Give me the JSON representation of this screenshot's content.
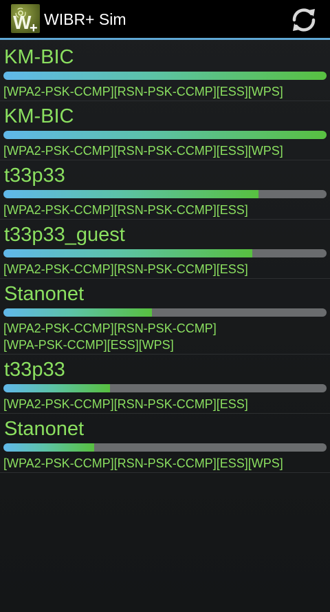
{
  "app": {
    "title": "WIBR+ Sim"
  },
  "colors": {
    "accent": "#5fa8d6",
    "text": "#8be060",
    "bar_track": "#6a6c6e"
  },
  "icons": {
    "app": "wibr-plus-logo-icon",
    "refresh": "refresh-icon"
  },
  "networks": [
    {
      "ssid": "KM-BIC",
      "signal": 1.0,
      "caps": [
        "[WPA2-PSK-CCMP][RSN-PSK-CCMP][ESS][WPS]"
      ]
    },
    {
      "ssid": "KM-BIC",
      "signal": 1.0,
      "caps": [
        "[WPA2-PSK-CCMP][RSN-PSK-CCMP][ESS][WPS]"
      ]
    },
    {
      "ssid": "t33p33",
      "signal": 0.79,
      "caps": [
        "[WPA2-PSK-CCMP][RSN-PSK-CCMP][ESS]"
      ]
    },
    {
      "ssid": "t33p33_guest",
      "signal": 0.77,
      "caps": [
        "[WPA2-PSK-CCMP][RSN-PSK-CCMP][ESS]"
      ]
    },
    {
      "ssid": "Stanonet",
      "signal": 0.46,
      "caps": [
        "[WPA2-PSK-CCMP][RSN-PSK-CCMP]",
        "[WPA-PSK-CCMP][ESS][WPS]"
      ]
    },
    {
      "ssid": "t33p33",
      "signal": 0.33,
      "caps": [
        "[WPA2-PSK-CCMP][RSN-PSK-CCMP][ESS]"
      ]
    },
    {
      "ssid": "Stanonet",
      "signal": 0.28,
      "caps": [
        "[WPA2-PSK-CCMP][RSN-PSK-CCMP][ESS][WPS]"
      ]
    }
  ]
}
